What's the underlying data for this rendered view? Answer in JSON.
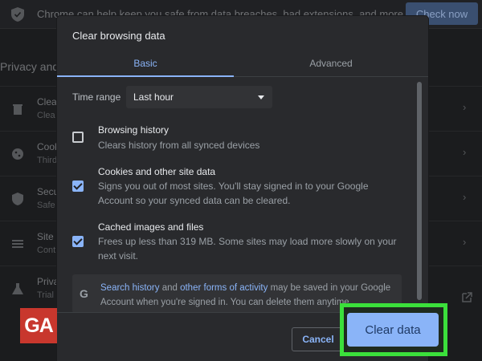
{
  "background": {
    "safety_text": "Chrome can help keep you safe from data breaches, bad extensions, and more",
    "check_now_label": "Check now",
    "privacy_heading": "Privacy and s",
    "rows": [
      {
        "title": "Clear",
        "sub": "Clea"
      },
      {
        "title": "Cook",
        "sub": "Third"
      },
      {
        "title": "Secu",
        "sub": "Safe"
      },
      {
        "title": "Site S",
        "sub": "Cont"
      },
      {
        "title": "Priva",
        "sub": "Trial"
      }
    ],
    "icons": [
      "trash-icon",
      "cookie-icon",
      "shield-icon",
      "sliders-icon",
      "flask-icon"
    ]
  },
  "dialog": {
    "title": "Clear browsing data",
    "tabs": [
      {
        "label": "Basic",
        "active": true
      },
      {
        "label": "Advanced",
        "active": false
      }
    ],
    "time_range": {
      "label": "Time range",
      "value": "Last hour"
    },
    "options": [
      {
        "title": "Browsing history",
        "description": "Clears history from all synced devices",
        "checked": false
      },
      {
        "title": "Cookies and other site data",
        "description": "Signs you out of most sites. You'll stay signed in to your Google Account so your synced data can be cleared.",
        "checked": true
      },
      {
        "title": "Cached images and files",
        "description": "Frees up less than 319 MB. Some sites may load more slowly on your next visit.",
        "checked": true
      }
    ],
    "info": {
      "icon": "G",
      "link1": "Search history",
      "text1": " and ",
      "link2": "other forms of activity",
      "text2": " may be saved in your Google Account when you're signed in. You can delete them anytime."
    },
    "cancel_label": "Cancel",
    "clear_label": "Clear data"
  },
  "watermark": "GA",
  "colors": {
    "accent": "#8ab4f8",
    "highlight": "#3be03b",
    "dialog_bg": "#292a2d",
    "logo_red": "#c8372d"
  }
}
